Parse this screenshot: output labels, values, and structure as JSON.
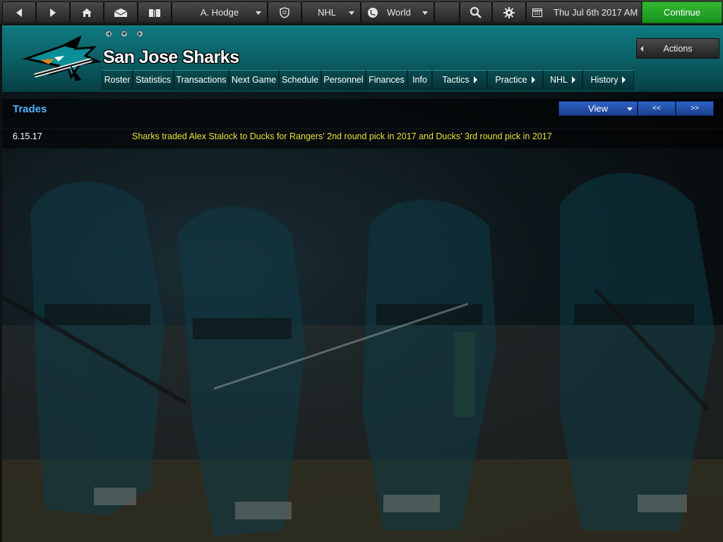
{
  "toolbar": {
    "manager": "A. Hodge",
    "league": "NHL",
    "region": "World",
    "date": "Thu Jul 6th 2017 AM",
    "continue_label": "Continue"
  },
  "header": {
    "team_name": "San Jose Sharks",
    "actions_label": "Actions",
    "tabs": [
      {
        "label": "Roster"
      },
      {
        "label": "Statistics"
      },
      {
        "label": "Transactions"
      },
      {
        "label": "Next Game"
      },
      {
        "label": "Schedule"
      },
      {
        "label": "Personnel"
      },
      {
        "label": "Finances"
      },
      {
        "label": "Info"
      },
      {
        "label": "Tactics"
      },
      {
        "label": "Practice"
      },
      {
        "label": "NHL"
      },
      {
        "label": "History"
      }
    ]
  },
  "trades": {
    "title": "Trades",
    "view_label": "View",
    "prev_label": "<<",
    "next_label": ">>",
    "rows": [
      {
        "date": "6.15.17",
        "text": "Sharks traded Alex Stalock to Ducks for Rangers' 2nd round pick in 2017 and Ducks' 3rd round pick in 2017"
      }
    ]
  },
  "colors": {
    "header_teal": "#0a5d63",
    "continue_green": "#1fa320",
    "trades_title": "#4fb3ff",
    "trade_text": "#e8e03c",
    "view_blue": "#2555b0"
  }
}
